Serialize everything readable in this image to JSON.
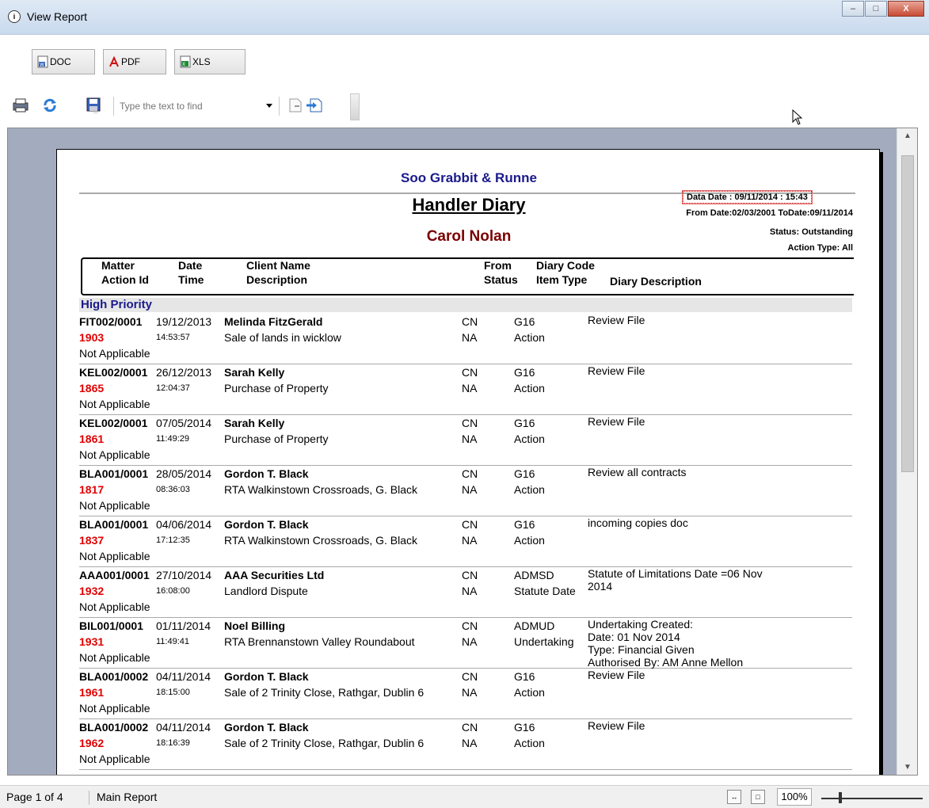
{
  "window": {
    "title": "View Report",
    "minimize": "–",
    "maximize": "□",
    "close": "X"
  },
  "export": {
    "doc_label": "DOC",
    "pdf_label": "PDF",
    "xls_label": "XLS"
  },
  "toolbar": {
    "search_placeholder": "Type the text to find"
  },
  "report": {
    "firm": "Soo Grabbit & Runne",
    "title": "Handler Diary",
    "handler": "Carol Nolan",
    "data_date": "Data Date :  09/11/2014 : 15:43",
    "from_to": "From Date:02/03/2001 ToDate:09/11/2014",
    "status": "Status: Outstanding",
    "action_type": "Action Type: All",
    "headers": {
      "matter": "Matter",
      "action_id": "Action Id",
      "date": "Date",
      "time": "Time",
      "client_name": "Client Name",
      "description": "Description",
      "from": "From",
      "status": "Status",
      "diary_code": "Diary Code",
      "item_type": "Item Type",
      "diary_description": "Diary Description"
    },
    "group": "High Priority",
    "entries": [
      {
        "matter": "FIT002/0001",
        "action_id": "1903",
        "applicable": "Not Applicable",
        "date": "19/12/2013",
        "time": "14:53:57",
        "client": "Melinda FitzGerald",
        "description": "Sale of lands in wicklow",
        "from": "CN",
        "status": "NA",
        "code": "G16",
        "item_type": "Action",
        "diary": [
          "Review File"
        ]
      },
      {
        "matter": "KEL002/0001",
        "action_id": "1865",
        "applicable": "Not Applicable",
        "date": "26/12/2013",
        "time": "12:04:37",
        "client": "Sarah Kelly",
        "description": "Purchase of Property",
        "from": "CN",
        "status": "NA",
        "code": "G16",
        "item_type": "Action",
        "diary": [
          "Review File"
        ]
      },
      {
        "matter": "KEL002/0001",
        "action_id": "1861",
        "applicable": "Not Applicable",
        "date": "07/05/2014",
        "time": "11:49:29",
        "client": "Sarah Kelly",
        "description": "Purchase of Property",
        "from": "CN",
        "status": "NA",
        "code": "G16",
        "item_type": "Action",
        "diary": [
          "Review File"
        ]
      },
      {
        "matter": "BLA001/0001",
        "action_id": "1817",
        "applicable": "Not Applicable",
        "date": "28/05/2014",
        "time": "08:36:03",
        "client": "Gordon T. Black",
        "description": "RTA Walkinstown Crossroads, G. Black",
        "from": "CN",
        "status": "NA",
        "code": "G16",
        "item_type": "Action",
        "diary": [
          "Review all contracts"
        ]
      },
      {
        "matter": "BLA001/0001",
        "action_id": "1837",
        "applicable": "Not Applicable",
        "date": "04/06/2014",
        "time": "17:12:35",
        "client": "Gordon T. Black",
        "description": "RTA Walkinstown Crossroads, G. Black",
        "from": "CN",
        "status": "NA",
        "code": "G16",
        "item_type": "Action",
        "diary": [
          "incoming copies doc"
        ]
      },
      {
        "matter": "AAA001/0001",
        "action_id": "1932",
        "applicable": "Not Applicable",
        "date": "27/10/2014",
        "time": "16:08:00",
        "client": "AAA Securities Ltd",
        "description": "Landlord Dispute",
        "from": "CN",
        "status": "NA",
        "code": "ADMSD",
        "item_type": "Statute Date",
        "diary": [
          "Statute of Limitations Date =06 Nov",
          "2014"
        ]
      },
      {
        "matter": "BIL001/0001",
        "action_id": "1931",
        "applicable": "Not Applicable",
        "date": "01/11/2014",
        "time": "11:49:41",
        "client": "Noel Billing",
        "description": "RTA Brennanstown Valley Roundabout",
        "from": "CN",
        "status": "NA",
        "code": "ADMUD",
        "item_type": "Undertaking",
        "diary": [
          "Undertaking Created:",
          "Date:  01 Nov 2014",
          "Type: Financial  Given",
          "Authorised By: AM Anne Mellon"
        ]
      },
      {
        "matter": "BLA001/0002",
        "action_id": "1961",
        "applicable": "Not Applicable",
        "date": "04/11/2014",
        "time": "18:15:00",
        "client": "Gordon T. Black",
        "description": "Sale of 2 Trinity Close, Rathgar, Dublin 6",
        "from": "CN",
        "status": "NA",
        "code": "G16",
        "item_type": "Action",
        "diary": [
          "Review File"
        ]
      },
      {
        "matter": "BLA001/0002",
        "action_id": "1962",
        "applicable": "Not Applicable",
        "date": "04/11/2014",
        "time": "18:16:39",
        "client": "Gordon T. Black",
        "description": "Sale of 2 Trinity Close, Rathgar, Dublin 6",
        "from": "CN",
        "status": "NA",
        "code": "G16",
        "item_type": "Action",
        "diary": [
          "Review File"
        ]
      }
    ]
  },
  "statusbar": {
    "page": "Page 1 of 4",
    "section": "Main Report",
    "zoom": "100%"
  },
  "colors": {
    "firm": "#1a1a8c",
    "handler": "#7a0000",
    "action_id": "#e00000",
    "viewer_bg": "#a3acbf"
  },
  "icons": [
    "print-icon",
    "refresh-icon",
    "save-icon",
    "prev-page-icon",
    "next-page-icon",
    "doc-icon",
    "pdf-icon",
    "xls-icon"
  ]
}
